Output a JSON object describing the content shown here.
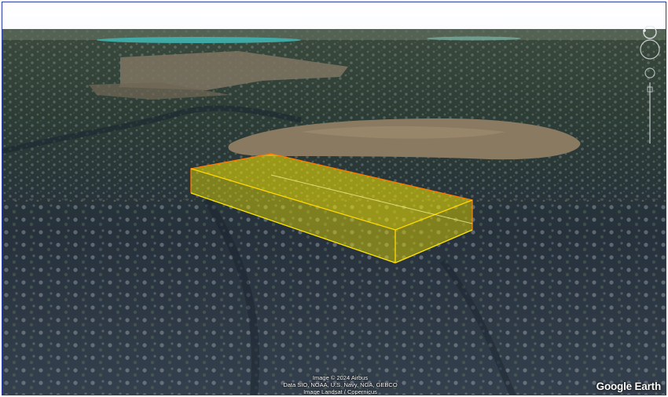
{
  "attribution": {
    "line1": "Image © 2024 Airbus",
    "line2": "Data SIO, NOAA, U.S. Navy, NGA, GEBCO",
    "line3": "Image Landsat / Copernicus"
  },
  "logo": "Google Earth",
  "colors": {
    "highlight_fill": "#f5e800",
    "highlight_edge": "#ff7a00",
    "terrain_dark": "#1f2a33",
    "clearing": "#8a7a62"
  },
  "icons": [
    "compass-icon",
    "look-joystick-icon",
    "zoom-slider-icon"
  ]
}
